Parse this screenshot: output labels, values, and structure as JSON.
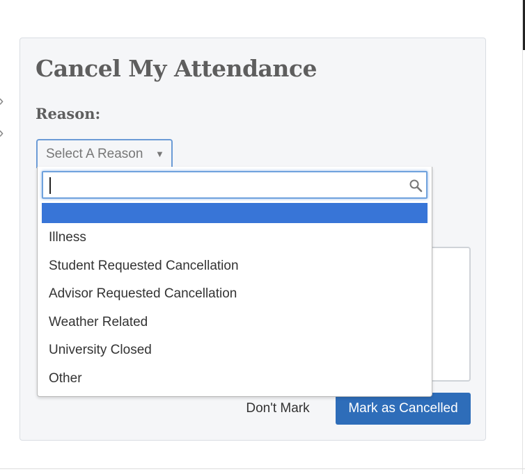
{
  "dialog": {
    "title": "Cancel My Attendance",
    "reason_label": "Reason:",
    "select": {
      "selected_value": "Select A Reason",
      "search_value": "",
      "options": [
        "Illness",
        "Student Requested Cancellation",
        "Advisor Requested Cancellation",
        "Weather Related",
        "University Closed",
        "Other"
      ]
    },
    "buttons": {
      "dont_mark": "Don't Mark",
      "mark_cancelled": "Mark as Cancelled"
    }
  },
  "colors": {
    "primary_button": "#2e6db9",
    "highlight": "#3875d7",
    "focus_border": "#6fa2dd",
    "panel_bg": "#f5f6f8",
    "heading_text": "#5e5e5e"
  },
  "icons": {
    "search": "search-icon",
    "dropdown_arrow": "triangle-down-icon"
  }
}
